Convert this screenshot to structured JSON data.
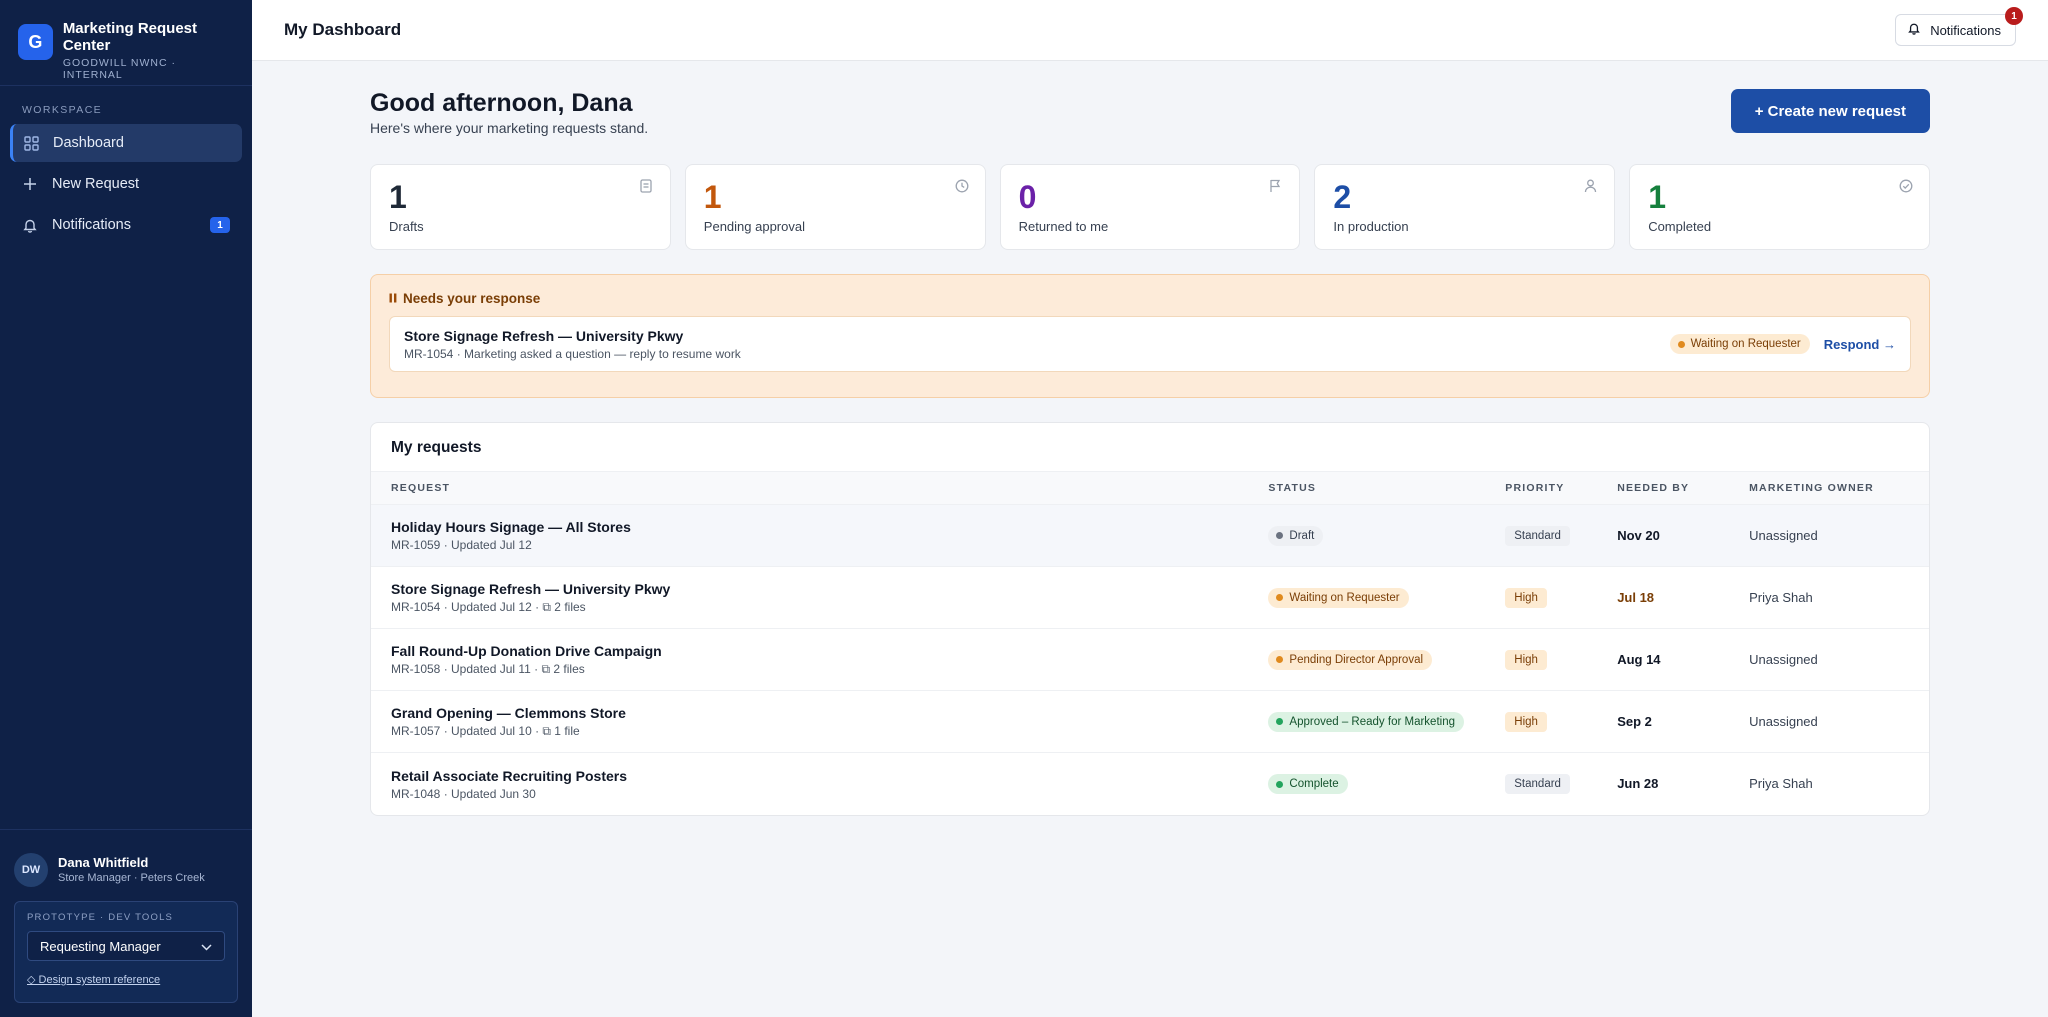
{
  "brand": {
    "logo_letter": "G",
    "title": "Marketing Request Center",
    "subtitle": "GOODWILL NWNC · INTERNAL"
  },
  "sidebar": {
    "section_label": "WORKSPACE",
    "items": [
      {
        "label": "Dashboard",
        "icon": "grid-icon",
        "active": true
      },
      {
        "label": "New Request",
        "icon": "plus-icon"
      },
      {
        "label": "Notifications",
        "icon": "bell-icon",
        "badge": "1"
      }
    ],
    "user": {
      "initials": "DW",
      "name": "Dana Whitfield",
      "role": "Store Manager · Peters Creek"
    },
    "devtools": {
      "label": "PROTOTYPE · DEV TOOLS",
      "role_select": "Requesting Manager",
      "link": "◇ Design system reference"
    }
  },
  "header": {
    "title": "My Dashboard",
    "notifications_label": "Notifications",
    "notifications_count": "1"
  },
  "greeting": {
    "title": "Good afternoon, Dana",
    "subtitle": "Here's where your marketing requests stand.",
    "create_button": "+ Create new request"
  },
  "stats": [
    {
      "value": "1",
      "label": "Drafts",
      "color": "#1f2937",
      "icon": "document-icon"
    },
    {
      "value": "1",
      "label": "Pending approval",
      "color": "#c2570c",
      "icon": "clock-icon"
    },
    {
      "value": "0",
      "label": "Returned to me",
      "color": "#6b21a8",
      "icon": "flag-icon"
    },
    {
      "value": "2",
      "label": "In production",
      "color": "#1d4ea6",
      "icon": "person-icon"
    },
    {
      "value": "1",
      "label": "Completed",
      "color": "#15803d",
      "icon": "check-circle-icon"
    }
  ],
  "needs_response": {
    "title": "Needs your response",
    "item": {
      "title": "Store Signage Refresh — University Pkwy",
      "subtitle": "MR-1054 · Marketing asked a question — reply to resume work",
      "status": "Waiting on Requester",
      "action": "Respond →"
    }
  },
  "requests": {
    "title": "My requests",
    "columns": [
      "REQUEST",
      "STATUS",
      "PRIORITY",
      "NEEDED BY",
      "MARKETING OWNER"
    ],
    "rows": [
      {
        "title": "Holiday Hours Signage — All Stores",
        "meta": "MR-1059 · Updated Jul 12",
        "status": "Draft",
        "status_kind": "draft",
        "priority": "Standard",
        "needed_by": "Nov 20",
        "owner": "Unassigned"
      },
      {
        "title": "Store Signage Refresh — University Pkwy",
        "meta": "MR-1054 · Updated Jul 12 · ⧉ 2 files",
        "status": "Waiting on Requester",
        "status_kind": "waiting",
        "priority": "High",
        "needed_by": "Jul 18",
        "needed_warn": true,
        "owner": "Priya Shah"
      },
      {
        "title": "Fall Round-Up Donation Drive Campaign",
        "meta": "MR-1058 · Updated Jul 11 · ⧉ 2 files",
        "status": "Pending Director Approval",
        "status_kind": "pending",
        "priority": "High",
        "needed_by": "Aug 14",
        "owner": "Unassigned"
      },
      {
        "title": "Grand Opening — Clemmons Store",
        "meta": "MR-1057 · Updated Jul 10 · ⧉ 1 file",
        "status": "Approved – Ready for Marketing",
        "status_kind": "approved",
        "priority": "High",
        "needed_by": "Sep 2",
        "owner": "Unassigned"
      },
      {
        "title": "Retail Associate Recruiting Posters",
        "meta": "MR-1048 · Updated Jun 30",
        "status": "Complete",
        "status_kind": "complete",
        "priority": "Standard",
        "needed_by": "Jun 28",
        "owner": "Priya Shah"
      }
    ]
  }
}
